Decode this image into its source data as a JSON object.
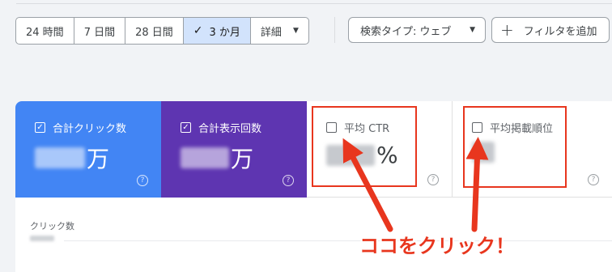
{
  "date_range": {
    "options": [
      "24 時間",
      "7 日間",
      "28 日間",
      "3 か月"
    ],
    "selected": "3 か月",
    "more_label": "詳細"
  },
  "search_type_label": "検索タイプ: ウェブ",
  "add_filter_label": "フィルタを追加",
  "metrics": {
    "clicks": {
      "title": "合計クリック数",
      "unit": "万",
      "checked": true,
      "color": "#4285f4"
    },
    "impressions": {
      "title": "合計表示回数",
      "unit": "万",
      "checked": true,
      "color": "#5e35b1"
    },
    "ctr": {
      "title": "平均 CTR",
      "unit": "%",
      "checked": false
    },
    "position": {
      "title": "平均掲載順位",
      "checked": false
    }
  },
  "chart": {
    "label": "クリック数"
  },
  "annotation": {
    "text": "ココをクリック！",
    "color": "#e8361e"
  }
}
